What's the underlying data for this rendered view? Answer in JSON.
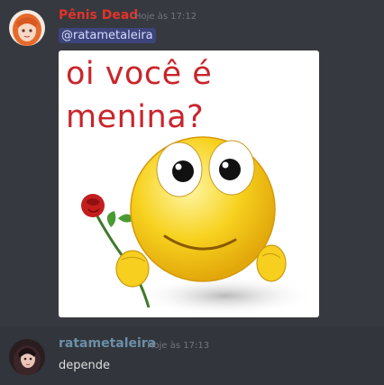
{
  "messages": [
    {
      "author": "Pênis Dead",
      "author_color": "#e0342c",
      "timestamp": "Hoje às 17:12",
      "mention": "@ratametaleira",
      "image": {
        "text_line_1": "oi você é",
        "text_line_2": "menina?",
        "text_color": "#c9252b"
      }
    },
    {
      "author": "ratametaleira",
      "author_color": "#6b8fa7",
      "timestamp": "Hoje às 17:13",
      "content": "depende"
    }
  ],
  "colors": {
    "background": "#36393f",
    "mention_bg": "#3c4479",
    "mention_text": "#d6dcff"
  },
  "icons": {
    "avatar_1": "orange-haired-anime-avatar",
    "avatar_2": "dark-haired-avatar",
    "emoji": "smiley-holding-rose"
  }
}
